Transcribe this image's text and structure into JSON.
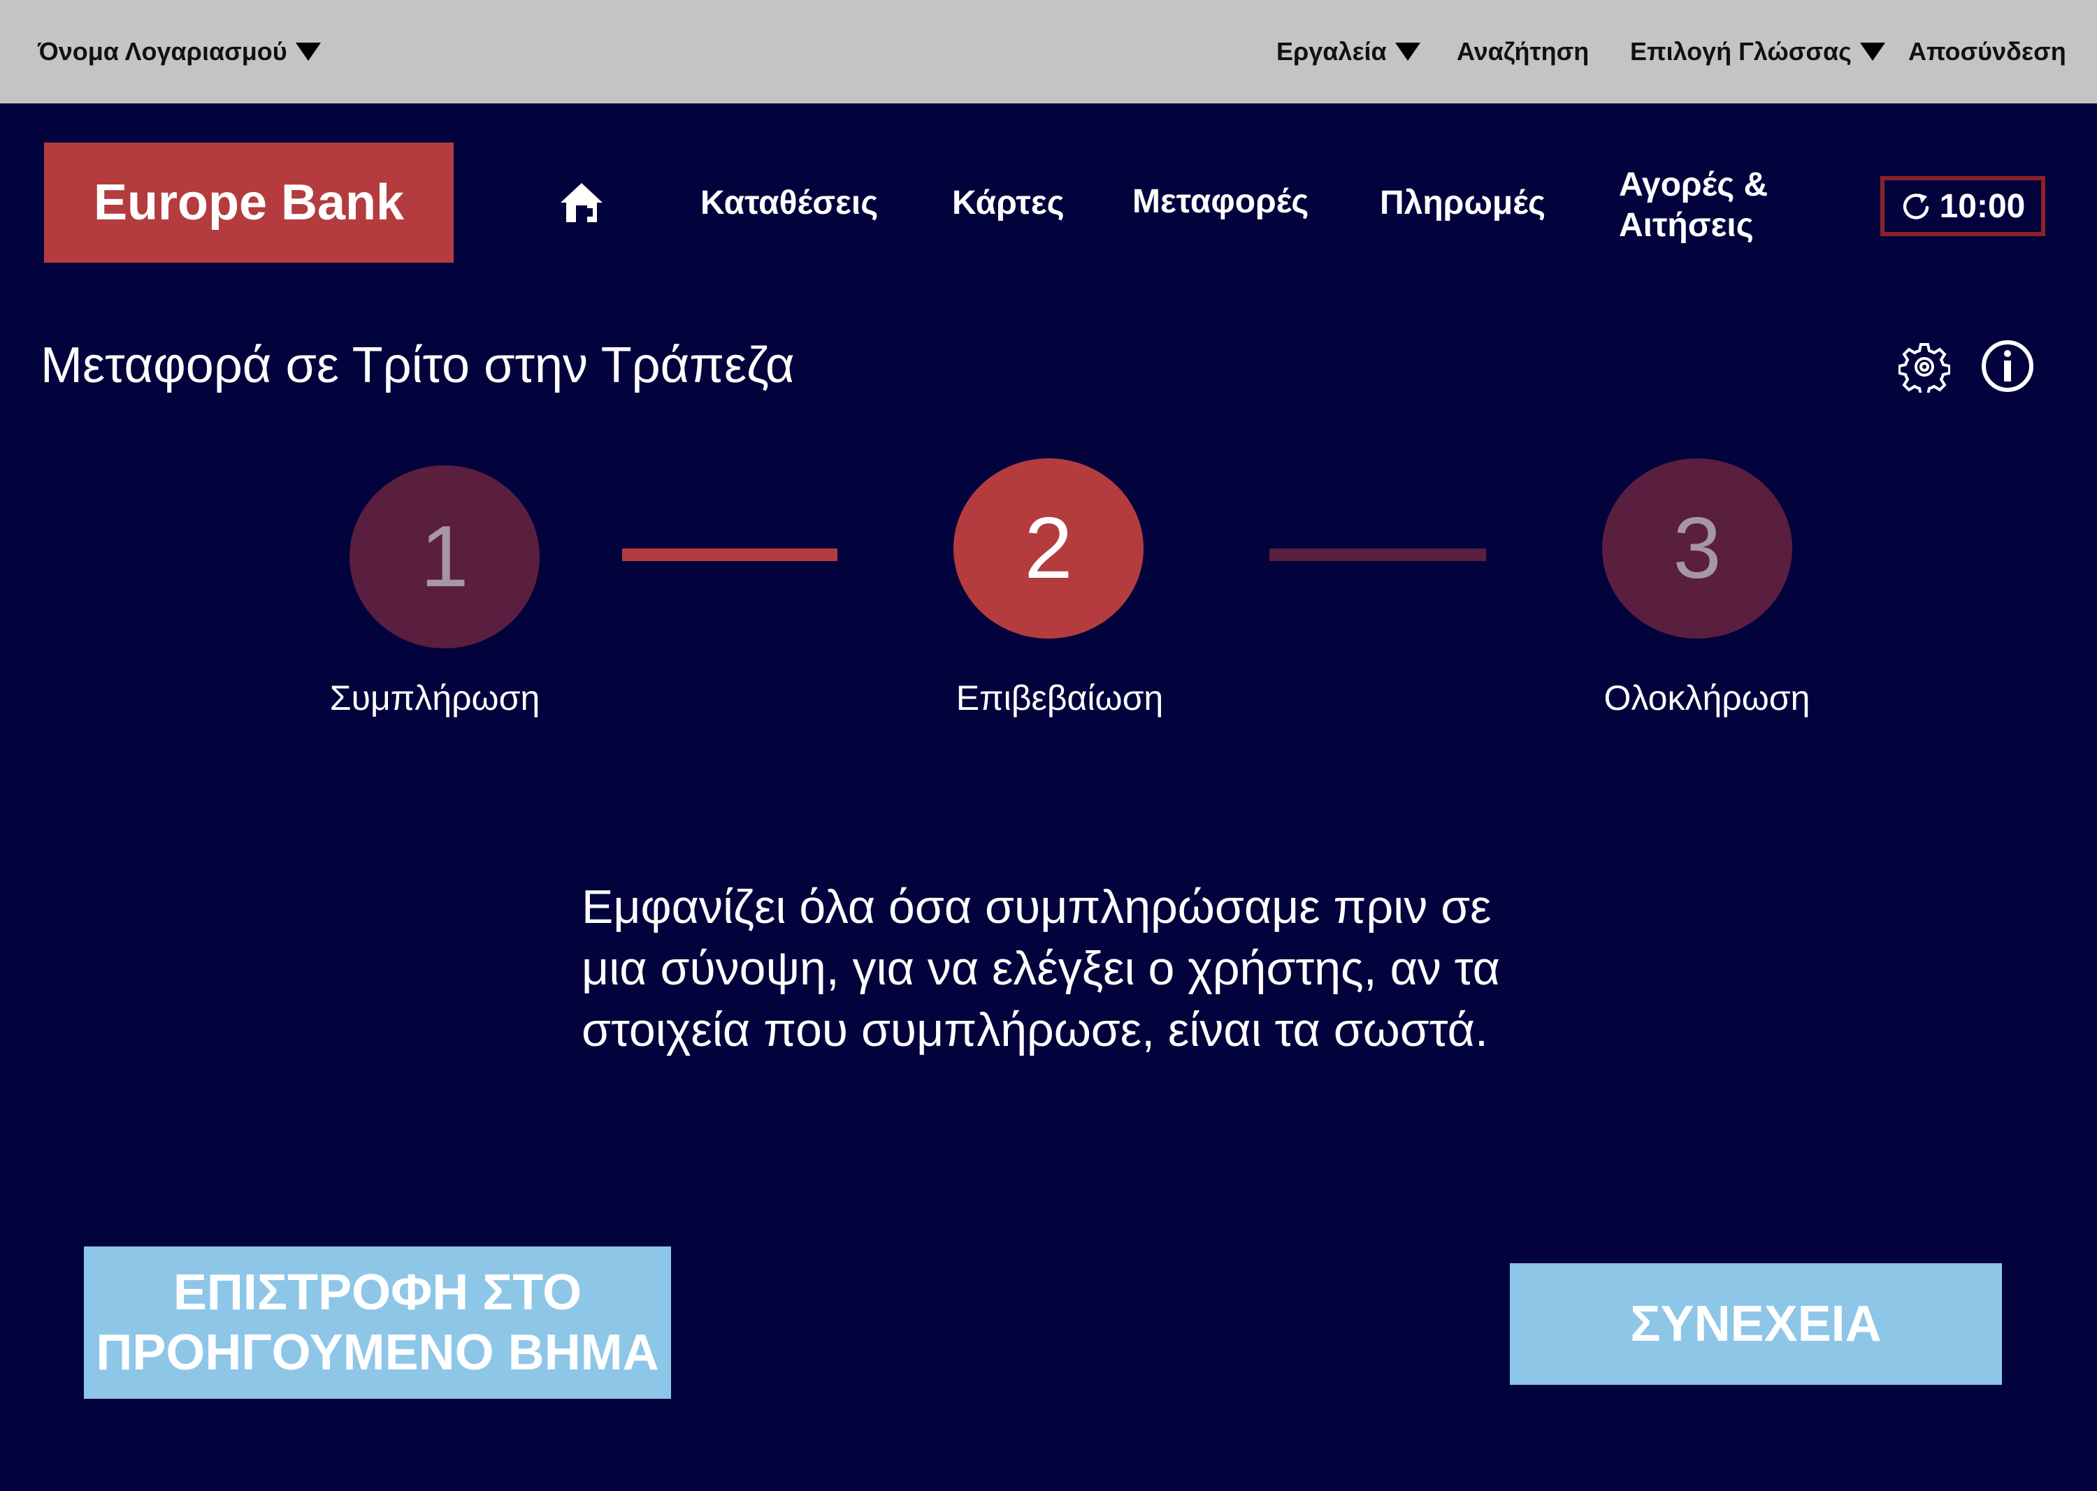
{
  "topbar": {
    "account_name": "Όνομα Λογαριασμού",
    "tools": "Εργαλεία",
    "search": "Αναζήτηση",
    "language": "Επιλογή Γλώσσας",
    "logout": "Αποσύνδεση"
  },
  "header": {
    "logo": "Europe Bank",
    "nav": {
      "deposits": "Καταθέσεις",
      "cards": "Κάρτες",
      "transfers": "Μεταφορές",
      "payments": "Πληρωμές",
      "purchases_line1": "Αγορές &",
      "purchases_line2": "Αιτήσεις"
    },
    "session_timer": "10:00"
  },
  "page": {
    "title": "Μεταφορά σε Τρίτο στην Τράπεζα"
  },
  "stepper": {
    "current_step": 2,
    "steps": [
      {
        "number": "1",
        "label": "Συμπλήρωση"
      },
      {
        "number": "2",
        "label": "Επιβεβαίωση"
      },
      {
        "number": "3",
        "label": "Ολοκλήρωση"
      }
    ]
  },
  "description": {
    "line1": "Εμφανίζει όλα όσα συμπληρώσαμε πριν σε",
    "line2": "μια σύνοψη, για να ελέγξει ο χρήστης, αν τα",
    "line3": "στοιχεία που συμπλήρωσε, είναι τα σωστά."
  },
  "actions": {
    "back_line1": "ΕΠΙΣΤΡΟΦΗ ΣΤΟ",
    "back_line2": "ΠΡΟΗΓΟΥΜΕΝΟ ΒΗΜΑ",
    "continue": "ΣΥΝΕΧΕΙΑ"
  },
  "colors": {
    "background": "#02023c",
    "topbar": "#c4c4c4",
    "brand_red": "#b43c3e",
    "inactive_step": "#5a1e3e",
    "button_blue": "#8ec6e8"
  },
  "icons": {
    "home": "home-icon",
    "refresh": "refresh-icon",
    "settings": "gear-icon",
    "info": "info-icon",
    "dropdown": "caret-down-icon"
  }
}
